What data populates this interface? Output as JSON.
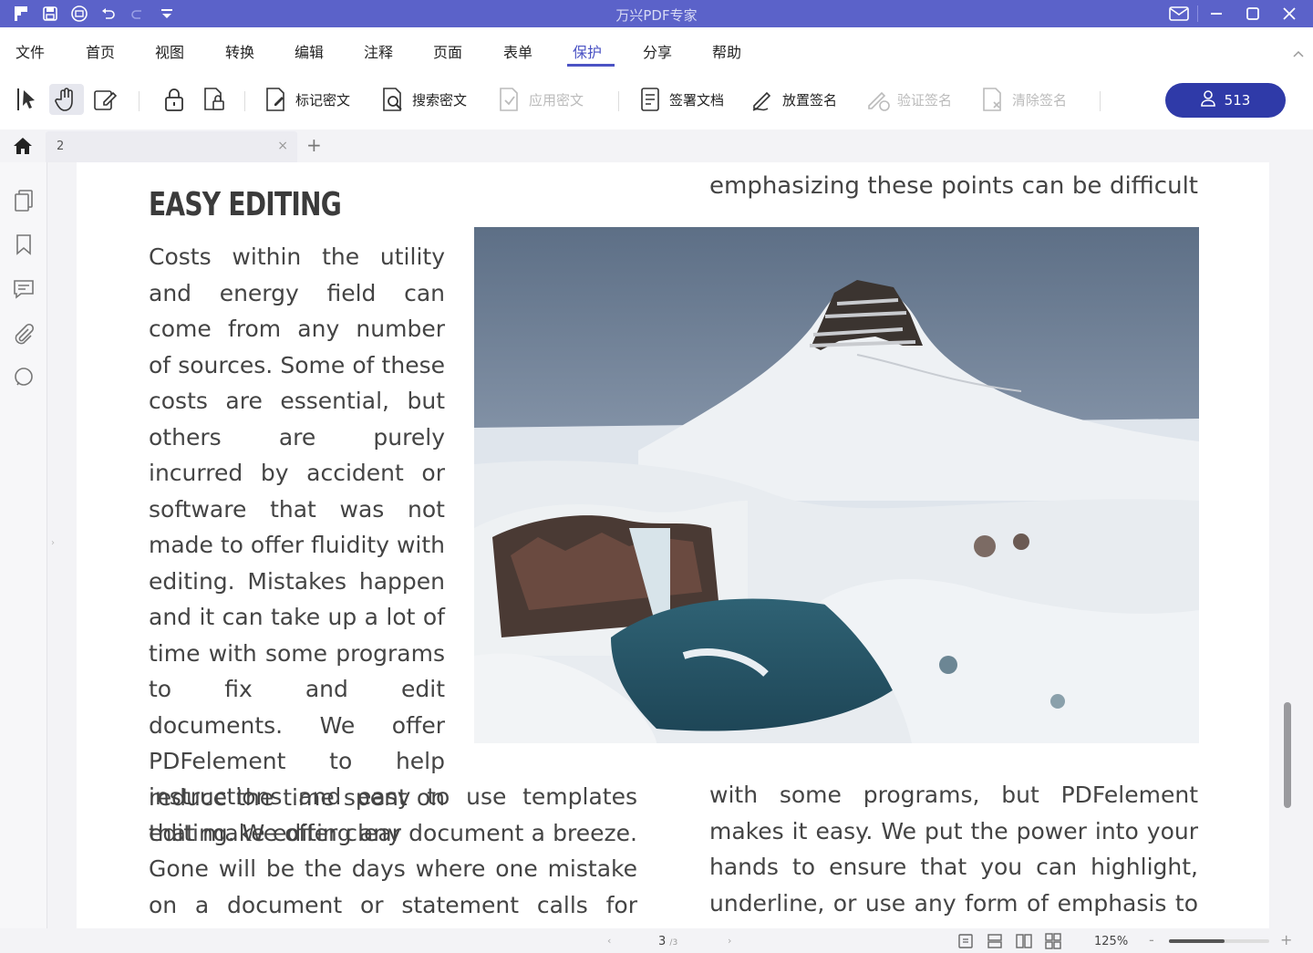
{
  "window": {
    "title": "万兴PDF专家",
    "accent_color": "#5b62c9"
  },
  "quick_access": [
    "app-logo-icon",
    "save-icon",
    "print-icon",
    "undo-icon",
    "redo-icon",
    "customize-icon"
  ],
  "menu": {
    "items": [
      "文件",
      "首页",
      "视图",
      "转换",
      "编辑",
      "注释",
      "页面",
      "表单",
      "保护",
      "分享",
      "帮助"
    ],
    "active": "保护"
  },
  "toolbar": {
    "mark_redaction": "标记密文",
    "search_redaction": "搜索密文",
    "apply_redaction": "应用密文",
    "sign_document": "签署文档",
    "place_signature": "放置签名",
    "verify_signature": "验证签名",
    "clear_signature": "清除签名",
    "user_count": "513"
  },
  "tabs": {
    "active_label": "2"
  },
  "document": {
    "heading": "EASY EDITING",
    "top_right_text": "emphasizing these points can be difficult",
    "column_a": "Costs within the utility and energy field can come from any number of sources. Some of these costs are essential, but others are purely incurred by accident or software that was not made to offer fluidity with editing. Mistakes happen and it can take up a lot of time with some programs to fix and edit documents. We offer PDFelement to help reduce the time spent on editing. We offer clear",
    "column_b": "instructions and easy to use templates that make editing any document a breeze. Gone will be the days where one mistake on a document or statement calls for hours wasted trying to",
    "column_c": "with some programs, but PDFelement makes it easy. We put the power into your hands to ensure that you can highlight, underline, or use any form of emphasis to make certain that"
  },
  "status": {
    "current_page": "3",
    "total_pages": "/3",
    "zoom": "125%",
    "zoom_fraction": 0.55
  }
}
